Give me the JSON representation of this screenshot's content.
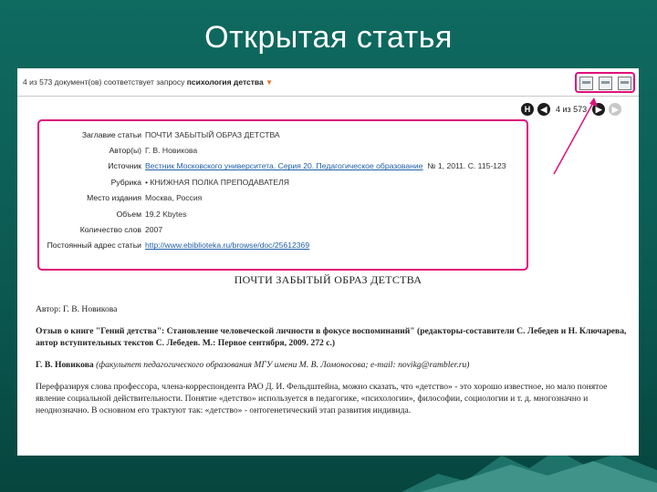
{
  "slide": {
    "title": "Открытая статья"
  },
  "toolbar": {
    "results_prefix": "4 из 573 документ(ов) соответствует запросу",
    "query": "психология детства",
    "tools": [
      "print-icon",
      "save-icon",
      "email-icon"
    ]
  },
  "pager": {
    "first": "H",
    "prev": "◀",
    "current": "4 из 573",
    "next": "▶",
    "last": "▶"
  },
  "meta": [
    {
      "label": "Заглавие статьи",
      "value": "ПОЧТИ ЗАБЫТЫЙ ОБРАЗ ДЕТСТВА"
    },
    {
      "label": "Автор(ы)",
      "value": "Г. В. Новикова"
    },
    {
      "label": "Источник",
      "link": "Вестник Московского университета. Серия 20. Педагогическое образование",
      "value": "№ 1, 2011. С. 115-123"
    },
    {
      "label": "Рубрика",
      "value": "• КНИЖНАЯ ПОЛКА ПРЕПОДАВАТЕЛЯ"
    },
    {
      "label": "Место издания",
      "value": "Москва, Россия"
    },
    {
      "label": "Объем",
      "value": "19.2 Kbytes"
    },
    {
      "label": "Количество слов",
      "value": "2007"
    },
    {
      "label": "Постоянный адрес статьи",
      "link": "http://www.ebiblioteka.ru/browse/doc/25612369"
    }
  ],
  "article": {
    "title": "ПОЧТИ ЗАБЫТЫЙ ОБРАЗ ДЕТСТВА",
    "author_line": "Автор: Г. В. Новикова",
    "review_text": "Отзыв о книге \"Гений детства\": Становление человеческой личности в фокусе воспоминаний\" (редакторы-составители С. Лебедев и Н. Ключарева, автор вступительных текстов С. Лебедев. М.: Первое сентября, 2009. 272 с.)",
    "affil_name": "Г. В. Новикова",
    "affil_text": "(факультет педагогического образования МГУ имени М. В. Ломоносова; e-mail: novikg@rambler.ru)",
    "para_text": "Перефразируя слова профессора, члена-корреспондента РАО Д. И. Фельдштейна, можно сказать, что «детство» - это хорошо известное, но мало понятое явление социальной действительности. Понятие «детство» используется в педагогике, «психологии», философии, социологии и т. д. многозначно и неоднозначно. В основном его трактуют так: «детство» - онтогенетический этап развития индивида."
  }
}
